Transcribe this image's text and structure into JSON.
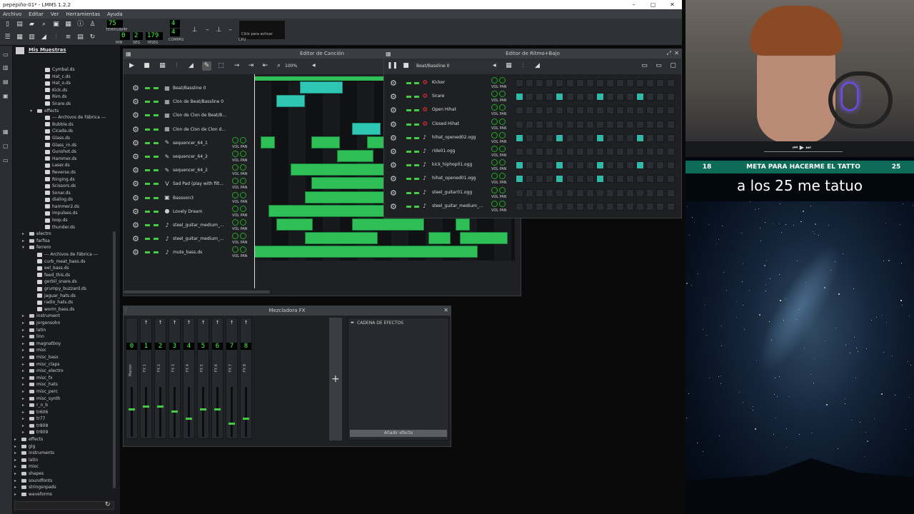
{
  "window": {
    "title": "pepepiño-01* - LMMS 1.2.2",
    "controls": [
      "–",
      "▢",
      "✕"
    ]
  },
  "menu": [
    "Archivo",
    "Editar",
    "Ver",
    "Herramientas",
    "Ayuda"
  ],
  "toolbar": {
    "tempo_value": "75",
    "tempo_label": "TEMPO/BPM",
    "time": {
      "min": "0",
      "seg": "2",
      "mseg": "179"
    },
    "time_labels": {
      "min": "MIN",
      "seg": "SEG",
      "mseg": "MSEG"
    },
    "time_sig": {
      "num": "4",
      "den": "4",
      "label": "COMPÁS"
    },
    "cpu_hint": "Click para activar",
    "cpu_label": "CPU"
  },
  "browser": {
    "header": "Mis Muestras",
    "items": [
      {
        "label": "Cymbal.ds",
        "depth": 3,
        "type": "file"
      },
      {
        "label": "Hat_c.ds",
        "depth": 3,
        "type": "file"
      },
      {
        "label": "Hat_o.ds",
        "depth": 3,
        "type": "file"
      },
      {
        "label": "Kick.ds",
        "depth": 3,
        "type": "file"
      },
      {
        "label": "Rim.ds",
        "depth": 3,
        "type": "file"
      },
      {
        "label": "Snare.ds",
        "depth": 3,
        "type": "file"
      },
      {
        "label": "effects",
        "depth": 2,
        "type": "folder",
        "open": true
      },
      {
        "label": "--- Archivos de Fábrica ---",
        "depth": 3,
        "type": "file"
      },
      {
        "label": "Bubble.ds",
        "depth": 3,
        "type": "file"
      },
      {
        "label": "Cicada.ds",
        "depth": 3,
        "type": "file"
      },
      {
        "label": "Glass.ds",
        "depth": 3,
        "type": "file"
      },
      {
        "label": "Glass_rn.ds",
        "depth": 3,
        "type": "file"
      },
      {
        "label": "Gunshot.ds",
        "depth": 3,
        "type": "file"
      },
      {
        "label": "Hammer.ds",
        "depth": 3,
        "type": "file"
      },
      {
        "label": "Laser.ds",
        "depth": 3,
        "type": "file"
      },
      {
        "label": "Reverse.ds",
        "depth": 3,
        "type": "file"
      },
      {
        "label": "Ringing.ds",
        "depth": 3,
        "type": "file"
      },
      {
        "label": "Scissors.ds",
        "depth": 3,
        "type": "file"
      },
      {
        "label": "Sonar.ds",
        "depth": 3,
        "type": "file"
      },
      {
        "label": "dialing.ds",
        "depth": 3,
        "type": "file"
      },
      {
        "label": "hammer2.ds",
        "depth": 3,
        "type": "file"
      },
      {
        "label": "impulses.ds",
        "depth": 3,
        "type": "file"
      },
      {
        "label": "loop.ds",
        "depth": 3,
        "type": "file"
      },
      {
        "label": "thunder.ds",
        "depth": 3,
        "type": "file"
      },
      {
        "label": "electro",
        "depth": 1,
        "type": "folder"
      },
      {
        "label": "farfisa",
        "depth": 1,
        "type": "folder"
      },
      {
        "label": "ferrero",
        "depth": 1,
        "type": "folder",
        "open": true
      },
      {
        "label": "--- Archivos de Fábrica ---",
        "depth": 2,
        "type": "file"
      },
      {
        "label": "curb_meat_bass.ds",
        "depth": 2,
        "type": "file"
      },
      {
        "label": "eel_bass.ds",
        "depth": 2,
        "type": "file"
      },
      {
        "label": "feed_this.ds",
        "depth": 2,
        "type": "file"
      },
      {
        "label": "gerbil_snare.ds",
        "depth": 2,
        "type": "file"
      },
      {
        "label": "grumpy_buzzard.ds",
        "depth": 2,
        "type": "file"
      },
      {
        "label": "jaguar_hats.ds",
        "depth": 2,
        "type": "file"
      },
      {
        "label": "radio_hats.ds",
        "depth": 2,
        "type": "file"
      },
      {
        "label": "worm_bass.ds",
        "depth": 2,
        "type": "file"
      },
      {
        "label": "instrument",
        "depth": 1,
        "type": "folder"
      },
      {
        "label": "jorgensohn",
        "depth": 1,
        "type": "folder"
      },
      {
        "label": "latin",
        "depth": 1,
        "type": "folder"
      },
      {
        "label": "linn",
        "depth": 1,
        "type": "folder"
      },
      {
        "label": "magnatboy",
        "depth": 1,
        "type": "folder"
      },
      {
        "label": "misc",
        "depth": 1,
        "type": "folder"
      },
      {
        "label": "misc_bass",
        "depth": 1,
        "type": "folder"
      },
      {
        "label": "misc_claps",
        "depth": 1,
        "type": "folder"
      },
      {
        "label": "misc_electro",
        "depth": 1,
        "type": "folder"
      },
      {
        "label": "misc_fx",
        "depth": 1,
        "type": "folder"
      },
      {
        "label": "misc_hats",
        "depth": 1,
        "type": "folder"
      },
      {
        "label": "misc_perc",
        "depth": 1,
        "type": "folder"
      },
      {
        "label": "misc_synth",
        "depth": 1,
        "type": "folder"
      },
      {
        "label": "r_n_b",
        "depth": 1,
        "type": "folder"
      },
      {
        "label": "tr606",
        "depth": 1,
        "type": "folder"
      },
      {
        "label": "tr77",
        "depth": 1,
        "type": "folder"
      },
      {
        "label": "tr808",
        "depth": 1,
        "type": "folder"
      },
      {
        "label": "tr909",
        "depth": 1,
        "type": "folder"
      },
      {
        "label": "effects",
        "depth": 0,
        "type": "folder"
      },
      {
        "label": "gig",
        "depth": 0,
        "type": "folder"
      },
      {
        "label": "instruments",
        "depth": 0,
        "type": "folder"
      },
      {
        "label": "latin",
        "depth": 0,
        "type": "folder"
      },
      {
        "label": "misc",
        "depth": 0,
        "type": "folder"
      },
      {
        "label": "shapes",
        "depth": 0,
        "type": "folder"
      },
      {
        "label": "soundfonts",
        "depth": 0,
        "type": "folder"
      },
      {
        "label": "stringsnpads",
        "depth": 0,
        "type": "folder"
      },
      {
        "label": "waveforms",
        "depth": 0,
        "type": "folder"
      }
    ]
  },
  "song_editor": {
    "title": "Editor de Canción",
    "zoom": "100%",
    "tracks": [
      {
        "name": "Beat/Bassline 0",
        "icon": "bb",
        "vp": false
      },
      {
        "name": "Clon de Beat/Bassline 0",
        "icon": "bb",
        "vp": false
      },
      {
        "name": "Clon de Clon de Beat/B...",
        "icon": "bb",
        "vp": false
      },
      {
        "name": "Clon de Clon de Clon d...",
        "icon": "bb",
        "vp": false
      },
      {
        "name": "sequencer_64_1",
        "icon": "inst",
        "vp": true
      },
      {
        "name": "sequencer_64_2",
        "icon": "inst",
        "vp": true
      },
      {
        "name": "sequencer_64_2",
        "icon": "inst",
        "vp": true
      },
      {
        "name": "Sad Pad (play with filt...",
        "icon": "v",
        "vp": true
      },
      {
        "name": "Bassoon3",
        "icon": "img",
        "vp": true
      },
      {
        "name": "Lovely Dream",
        "icon": "circ",
        "vp": true
      },
      {
        "name": "steel_guitar_medium_...",
        "icon": "note",
        "vp": true
      },
      {
        "name": "steel_guitar_medium_...",
        "icon": "note",
        "vp": true
      },
      {
        "name": "mute_bass.ds",
        "icon": "note",
        "vp": true
      }
    ],
    "vol_label": "VOL",
    "pan_label": "PAN",
    "blocks": [
      {
        "row": 0,
        "start": 0.35,
        "len": 0.33,
        "c": "t"
      },
      {
        "row": 1,
        "start": 0.17,
        "len": 0.22,
        "c": "t"
      },
      {
        "row": 3,
        "start": 0.75,
        "len": 0.22,
        "c": "t"
      },
      {
        "row": 4,
        "start": 0.05,
        "len": 0.11,
        "c": "g"
      },
      {
        "row": 4,
        "start": 0.44,
        "len": 0.22,
        "c": "g"
      },
      {
        "row": 4,
        "start": 0.87,
        "len": 0.13,
        "c": "g"
      },
      {
        "row": 5,
        "start": 0.64,
        "len": 0.28,
        "c": "g"
      },
      {
        "row": 6,
        "start": 0.28,
        "len": 0.72,
        "c": "g"
      },
      {
        "row": 7,
        "start": 0.44,
        "len": 0.56,
        "c": "g"
      },
      {
        "row": 8,
        "start": 0.39,
        "len": 0.61,
        "c": "g"
      },
      {
        "row": 9,
        "start": 0.11,
        "len": 0.89,
        "c": "g"
      },
      {
        "row": 10,
        "start": 0.17,
        "len": 0.28,
        "c": "g"
      },
      {
        "row": 10,
        "start": 0.75,
        "len": 0.56,
        "c": "g"
      },
      {
        "row": 10,
        "start": 1.55,
        "len": 0.11,
        "c": "g"
      },
      {
        "row": 11,
        "start": 0.39,
        "len": 0.56,
        "c": "g"
      },
      {
        "row": 11,
        "start": 1.34,
        "len": 0.17,
        "c": "g"
      },
      {
        "row": 11,
        "start": 1.58,
        "len": 0.37,
        "c": "g"
      },
      {
        "row": 12,
        "start": 0.0,
        "len": 1.72,
        "c": "g"
      }
    ]
  },
  "bb_editor": {
    "title": "Editor de Ritmo+Bajo",
    "pattern": "Beat/Bassline 0",
    "vol_label": "VOL",
    "pan_label": "PAN",
    "rows": [
      {
        "name": "Kicker",
        "icon": "ks",
        "steps": []
      },
      {
        "name": "Snare",
        "icon": "ks",
        "steps": [
          0,
          4,
          8,
          12
        ]
      },
      {
        "name": "Open Hihat",
        "icon": "ks",
        "steps": []
      },
      {
        "name": "Closed Hihat",
        "icon": "ks",
        "steps": []
      },
      {
        "name": "hihat_opened02.ogg",
        "icon": "note",
        "steps": [
          0,
          4,
          8,
          12
        ]
      },
      {
        "name": "ride01.ogg",
        "icon": "note",
        "steps": []
      },
      {
        "name": "kick_hiphop01.ogg",
        "icon": "note",
        "steps": [
          0,
          4,
          8,
          12
        ]
      },
      {
        "name": "hihat_opened01.ogg",
        "icon": "note",
        "steps": [
          0,
          4,
          8
        ]
      },
      {
        "name": "steel_guitar01.ogg",
        "icon": "note",
        "steps": []
      },
      {
        "name": "steel_guitar_medium_...",
        "icon": "note",
        "steps": []
      }
    ]
  },
  "mixer": {
    "title": "Mezcladora FX",
    "channels": [
      {
        "num": "0",
        "label": "Master",
        "level": 0.55
      },
      {
        "num": "1",
        "label": "FX 1",
        "level": 0.6
      },
      {
        "num": "2",
        "label": "FX 2",
        "level": 0.6
      },
      {
        "num": "3",
        "label": "FX 3",
        "level": 0.5
      },
      {
        "num": "4",
        "label": "FX 4",
        "level": 0.35
      },
      {
        "num": "5",
        "label": "FX 5",
        "level": 0.55
      },
      {
        "num": "6",
        "label": "FX 6",
        "level": 0.55
      },
      {
        "num": "7",
        "label": "FX 7",
        "level": 0.25
      },
      {
        "num": "8",
        "label": "FX 8",
        "level": 0.35
      }
    ],
    "chain_title": "CADENA DE EFECTOS",
    "add_effect": "Añadir efecto"
  },
  "stream": {
    "goal_start": "18",
    "goal_label": "META PARA HACERME EL TATTO",
    "goal_end": "25",
    "caption": "a los 25 me tatuo"
  },
  "colors": {
    "accent": "#2fbf57",
    "teal": "#2fc7b4",
    "lcd": "#44ff44"
  }
}
